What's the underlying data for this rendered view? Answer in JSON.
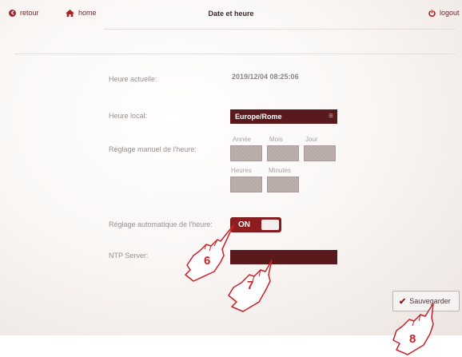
{
  "header": {
    "back_label": "retour",
    "home_label": "home",
    "title": "Date et heure",
    "logout_label": "logout"
  },
  "form": {
    "current_time_label": "Heure actuelle:",
    "current_time_value": "2019/12/04 08:25:06",
    "timezone_label": "Heure local:",
    "timezone_value": "Europe/Rome",
    "manual_label": "Réglage manuel de l'heure:",
    "year_label": "Année",
    "month_label": "Mois",
    "day_label": "Jour",
    "hours_label": "Heures",
    "minutes_label": "Minutes",
    "auto_label": "Réglage automatique de l'heure:",
    "auto_state": "ON",
    "ntp_label": "NTP Server:",
    "ntp_value": ""
  },
  "actions": {
    "save_label": "Sauvegarder"
  },
  "callouts": [
    "6",
    "7",
    "8"
  ],
  "colors": {
    "brand_dark": "#5a1a1c",
    "brand_red": "#8d1d20",
    "callout_red": "#cc1f27"
  }
}
